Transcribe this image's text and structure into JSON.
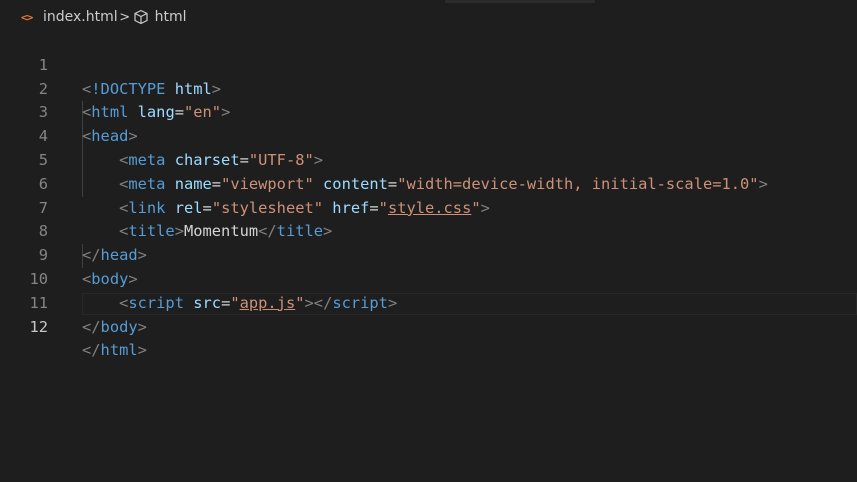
{
  "breadcrumb": {
    "file_icon": "<>",
    "file_name": "index.html",
    "separator": ">",
    "symbol_name": "html"
  },
  "editor": {
    "active_line": 12,
    "lines": [
      {
        "n": "1"
      },
      {
        "n": "2"
      },
      {
        "n": "3"
      },
      {
        "n": "4"
      },
      {
        "n": "5"
      },
      {
        "n": "6"
      },
      {
        "n": "7"
      },
      {
        "n": "8"
      },
      {
        "n": "9"
      },
      {
        "n": "10"
      },
      {
        "n": "11"
      },
      {
        "n": "12"
      }
    ],
    "tokens": {
      "lt": "<",
      "gt": ">",
      "lt_slash": "</",
      "doctype": "!DOCTYPE",
      "html": "html",
      "lang_attr": "lang",
      "lang_val": "\"en\"",
      "head": "head",
      "meta": "meta",
      "charset_attr": "charset",
      "charset_val": "\"UTF-8\"",
      "name_attr": "name",
      "name_val": "\"viewport\"",
      "content_attr": "content",
      "content_val": "\"width=device-width, initial-scale=1.0\"",
      "link": "link",
      "rel_attr": "rel",
      "rel_val": "\"stylesheet\"",
      "href_attr": "href",
      "href_q": "\"",
      "href_val": "style.css",
      "title": "title",
      "title_text": "Momentum",
      "body": "body",
      "script": "script",
      "src_attr": "src",
      "src_val": "app.js",
      "eq": "="
    }
  },
  "colors": {
    "background": "#1e1e1e",
    "tag": "#569cd6",
    "attribute": "#9cdcfe",
    "string": "#ce9178",
    "punctuation": "#808080",
    "text": "#d4d4d4",
    "line_number": "#858585",
    "file_icon": "#e37933"
  }
}
